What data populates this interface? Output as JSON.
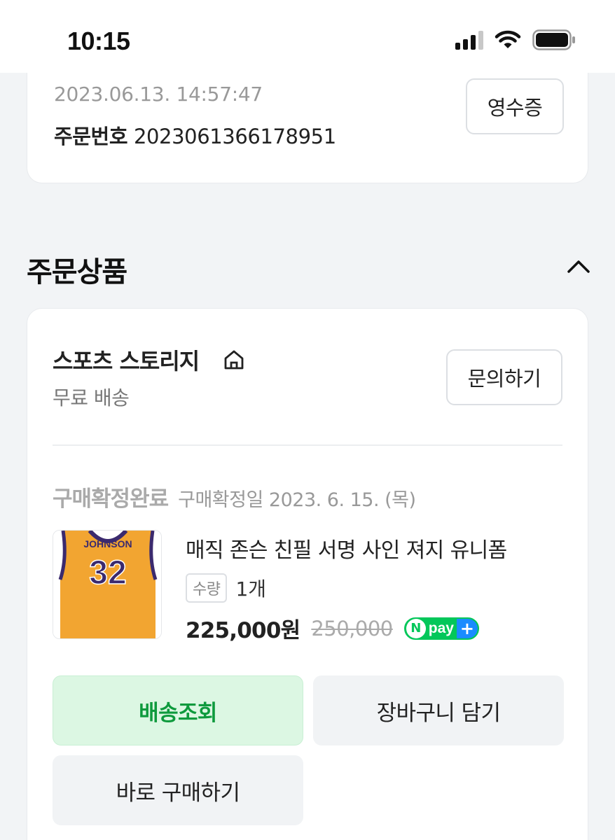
{
  "status_bar": {
    "time": "10:15",
    "icons": [
      "signal-icon",
      "wifi-icon",
      "battery-icon"
    ]
  },
  "order": {
    "datetime": "2023.06.13. 14:57:47",
    "number_label": "주문번호",
    "number_value": "2023061366178951",
    "receipt_label": "영수증"
  },
  "section": {
    "title": "주문상품",
    "toggle_icon": "chevron-up-icon"
  },
  "seller": {
    "name": "스포츠 스토리지",
    "home_icon": "home-icon",
    "shipping": "무료 배송",
    "inquiry_label": "문의하기"
  },
  "item": {
    "status": "구매확정완료",
    "confirm_date": "구매확정일 2023. 6. 15. (목)",
    "jersey_name": "JOHNSON",
    "jersey_number": "32",
    "title": "매직 존슨 친필 서명 사인 져지 유니폼",
    "qty_label": "수량",
    "qty_value": "1개",
    "price": "225,000원",
    "original_price": "250,000",
    "npay_n": "N",
    "npay_text": "pay",
    "npay_plus": "+"
  },
  "actions": {
    "track": "배송조회",
    "cart": "장바구니 담기",
    "buy": "바로 구매하기"
  },
  "colors": {
    "accent_green": "#0e9a3d",
    "track_bg": "#dcf7e3",
    "npay_green": "#03c75a",
    "npay_blue": "#1a8cff",
    "jersey_gold": "#f2a531",
    "jersey_purple": "#3b2a6e"
  }
}
